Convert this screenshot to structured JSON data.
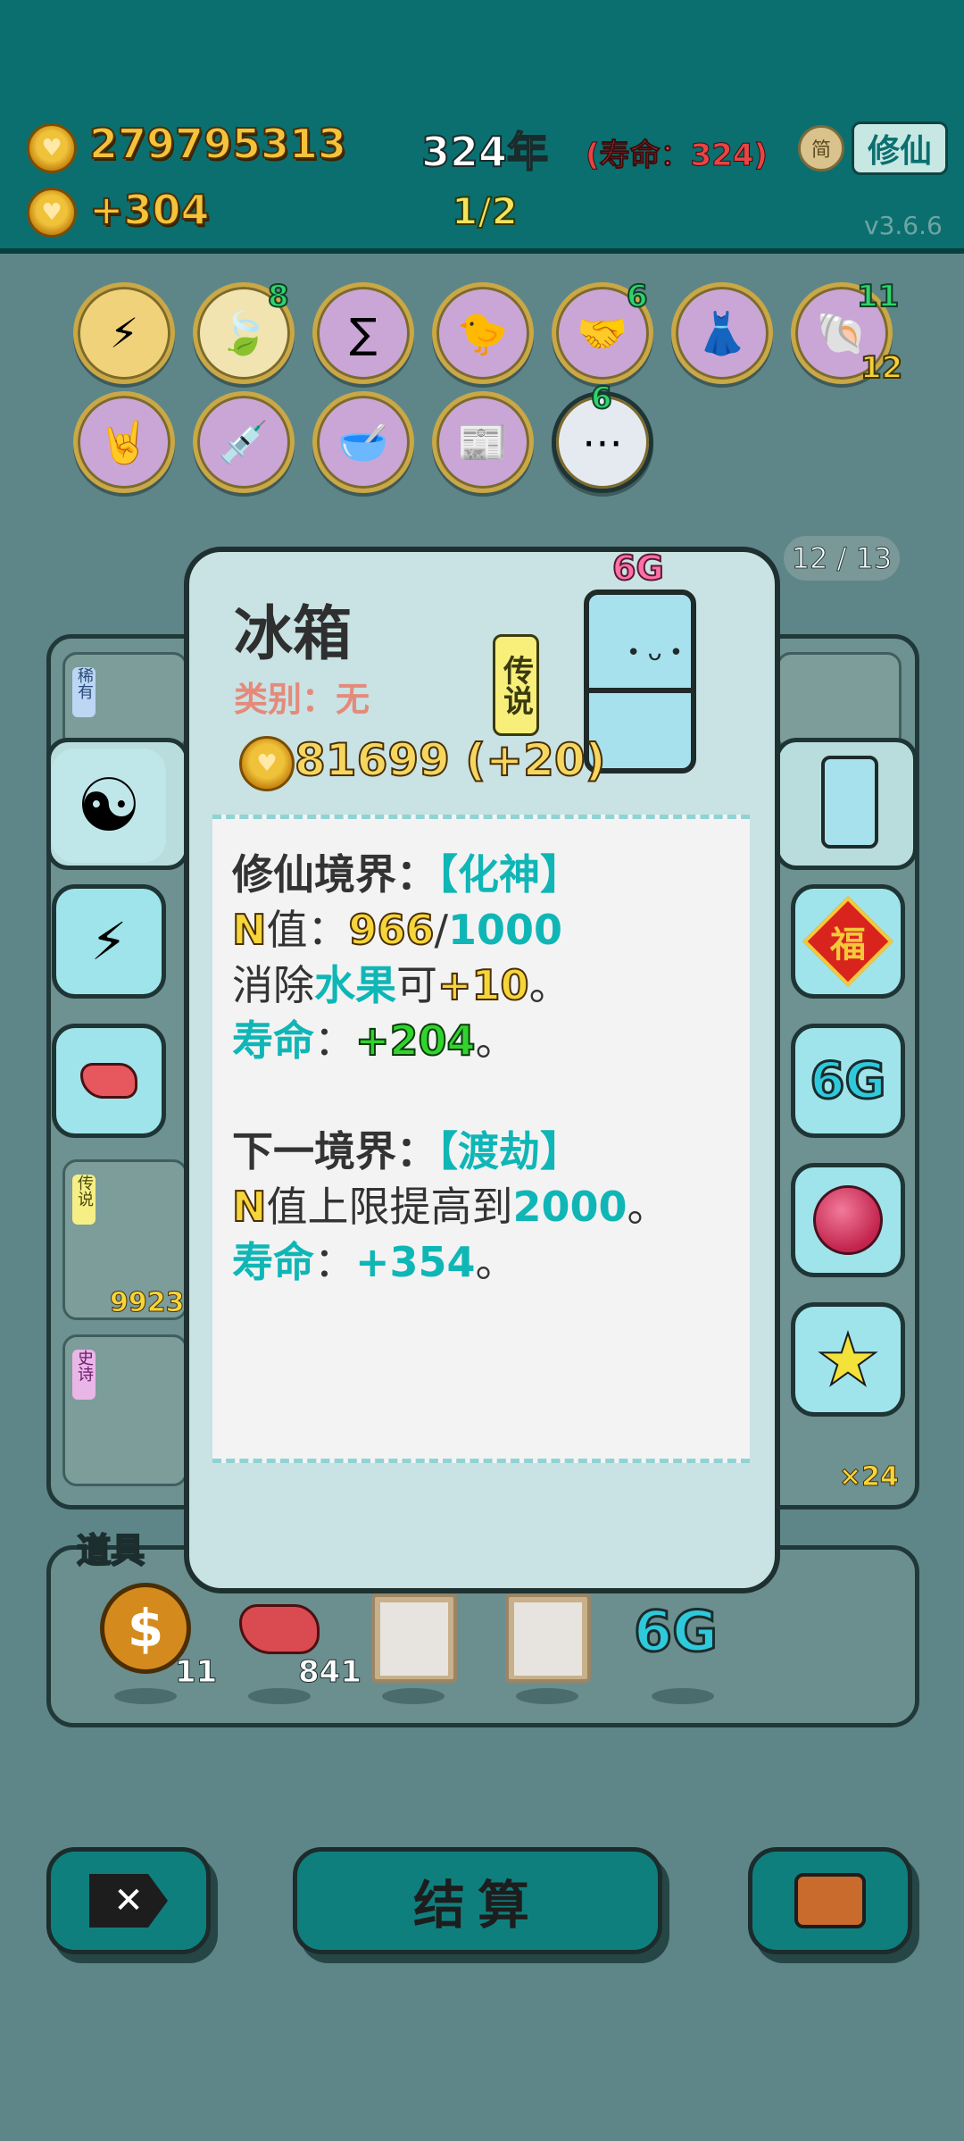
{
  "header": {
    "coins": "279795313",
    "coin_rate": "+304",
    "year": "324年",
    "lifespan": "(寿命：324)",
    "pages": "1/2",
    "simplified": "简",
    "xiuxian_button": "修仙",
    "version": "v3.6.6"
  },
  "badges": [
    {
      "icon": "lightning-icon",
      "count": ""
    },
    {
      "icon": "leaf-icon",
      "count": "8"
    },
    {
      "icon": "formula-icon",
      "count": ""
    },
    {
      "icon": "chick-icon",
      "count": ""
    },
    {
      "icon": "handshake-icon",
      "count": "6"
    },
    {
      "icon": "skirt-icon",
      "count": ""
    },
    {
      "icon": "shell-icon",
      "count": "11",
      "count2": "12"
    },
    {
      "icon": "rock-hand-icon",
      "count": ""
    },
    {
      "icon": "syringe-chick-icon",
      "count": ""
    },
    {
      "icon": "bowl-icon",
      "count": ""
    },
    {
      "icon": "time-cover-icon",
      "count": ""
    },
    {
      "icon": "egg-tray-icon",
      "count": "6"
    }
  ],
  "board": {
    "page_indicator": "12 / 13",
    "card_tags": [
      "稀有",
      "传说",
      "史诗"
    ],
    "card_numbers": [
      "9923"
    ],
    "right_count": "×24"
  },
  "modal": {
    "name": "冰箱",
    "category": "类别：无",
    "rarity": "传说",
    "price": "81699 (+20)",
    "tag_6g": "6G",
    "realm_label": "修仙境界：",
    "realm_value": "【化神】",
    "n_prefix": "N",
    "n_label": "值：",
    "n_current": "966",
    "n_sep": "/",
    "n_max": "1000",
    "eliminate_pre": "消除",
    "eliminate_target": "水果",
    "eliminate_mid": "可",
    "eliminate_bonus": "+10",
    "period": "。",
    "life_label": "寿命",
    "life_colon": "：",
    "life_value": "+204",
    "next_label": "下一境界：",
    "next_value": "【渡劫】",
    "n_cap_text": "值上限提高到",
    "n_cap_value": "2000",
    "next_life_value": "+354"
  },
  "side": {
    "left_buttons": [
      "yin-yang-icon",
      "lightning-icon",
      "liver-icon"
    ],
    "right_buttons": [
      "fridge-icon",
      "fu-icon",
      "6g-icon",
      "lychee-icon",
      "star-icon"
    ],
    "right_6g": "6G",
    "fu_char": "福"
  },
  "tools": {
    "label": "道具",
    "items": [
      {
        "icon": "coin-icon",
        "count": "11"
      },
      {
        "icon": "liver-icon",
        "count": "841"
      },
      {
        "icon": "empty-slot-icon",
        "count": ""
      },
      {
        "icon": "empty-slot-icon",
        "count": ""
      },
      {
        "icon": "6g-icon",
        "count": "",
        "label": "6G"
      }
    ]
  },
  "bottom": {
    "settle": "结算",
    "exit_icon": "exit-icon",
    "bag_icon": "briefcase-icon"
  }
}
